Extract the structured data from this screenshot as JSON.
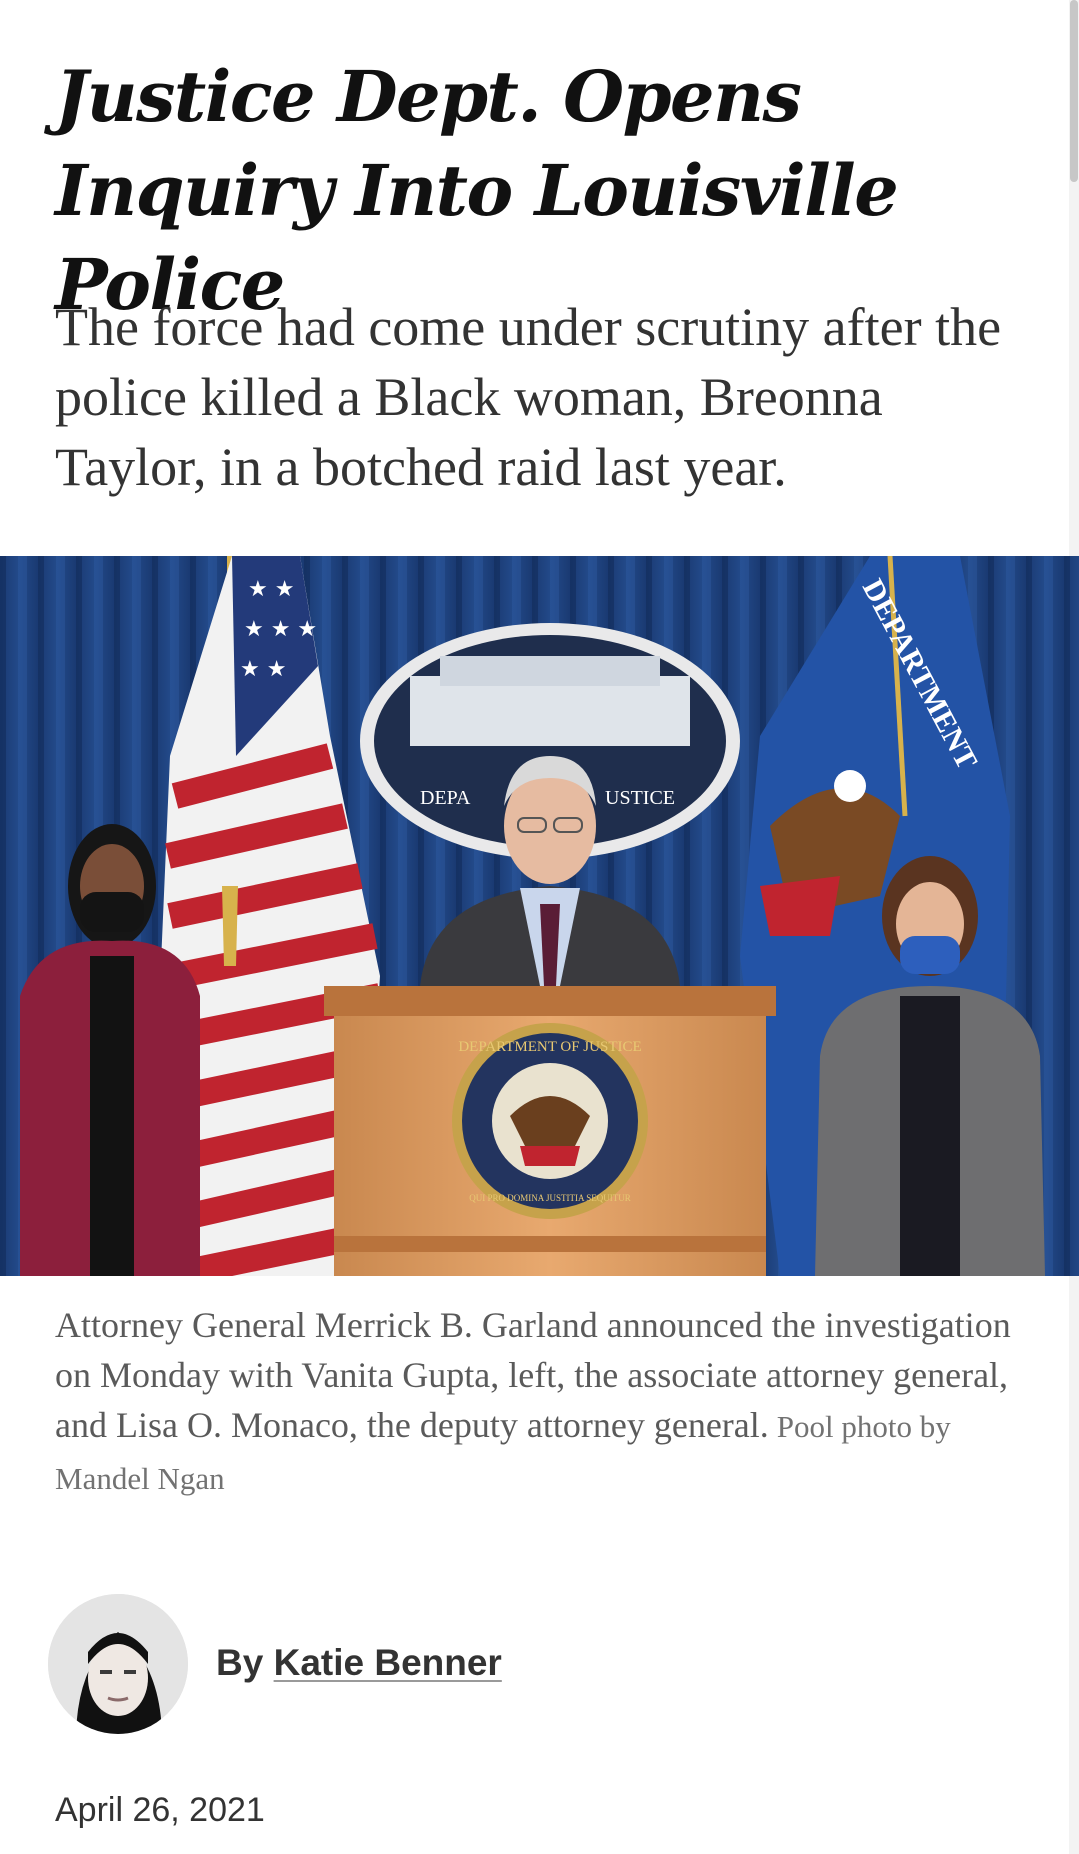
{
  "article": {
    "headline": "Justice Dept. Opens Inquiry Into Louisville Police",
    "summary": "The force had come under scrutiny after the police killed a Black woman, Breonna Taylor, in a botched raid last year.",
    "caption": "Attorney General Merrick B. Garland announced the investigation on Monday with Vanita Gupta, left, the associate attorney general, and Lisa O. Monaco, the deputy attorney general.",
    "photo_credit": "Pool photo by Mandel Ngan",
    "byline_prefix": "By",
    "author": "Katie Benner",
    "date": "April 26, 2021"
  },
  "photo_text": {
    "seal_top": "DEPA",
    "seal_right": "USTICE",
    "flag_lettering": "DEPARTMENT",
    "podium_seal": "DEPARTMENT OF JUSTICE",
    "podium_motto": "QUI PRO DOMINA JUSTITIA SEQUITUR"
  },
  "colors": {
    "headline": "#111111",
    "body": "#333333",
    "caption": "#5a5a5a",
    "curtain": "#1d3f7a",
    "podium": "#d99a62"
  },
  "icons": {
    "avatar": "author-avatar-photo"
  }
}
